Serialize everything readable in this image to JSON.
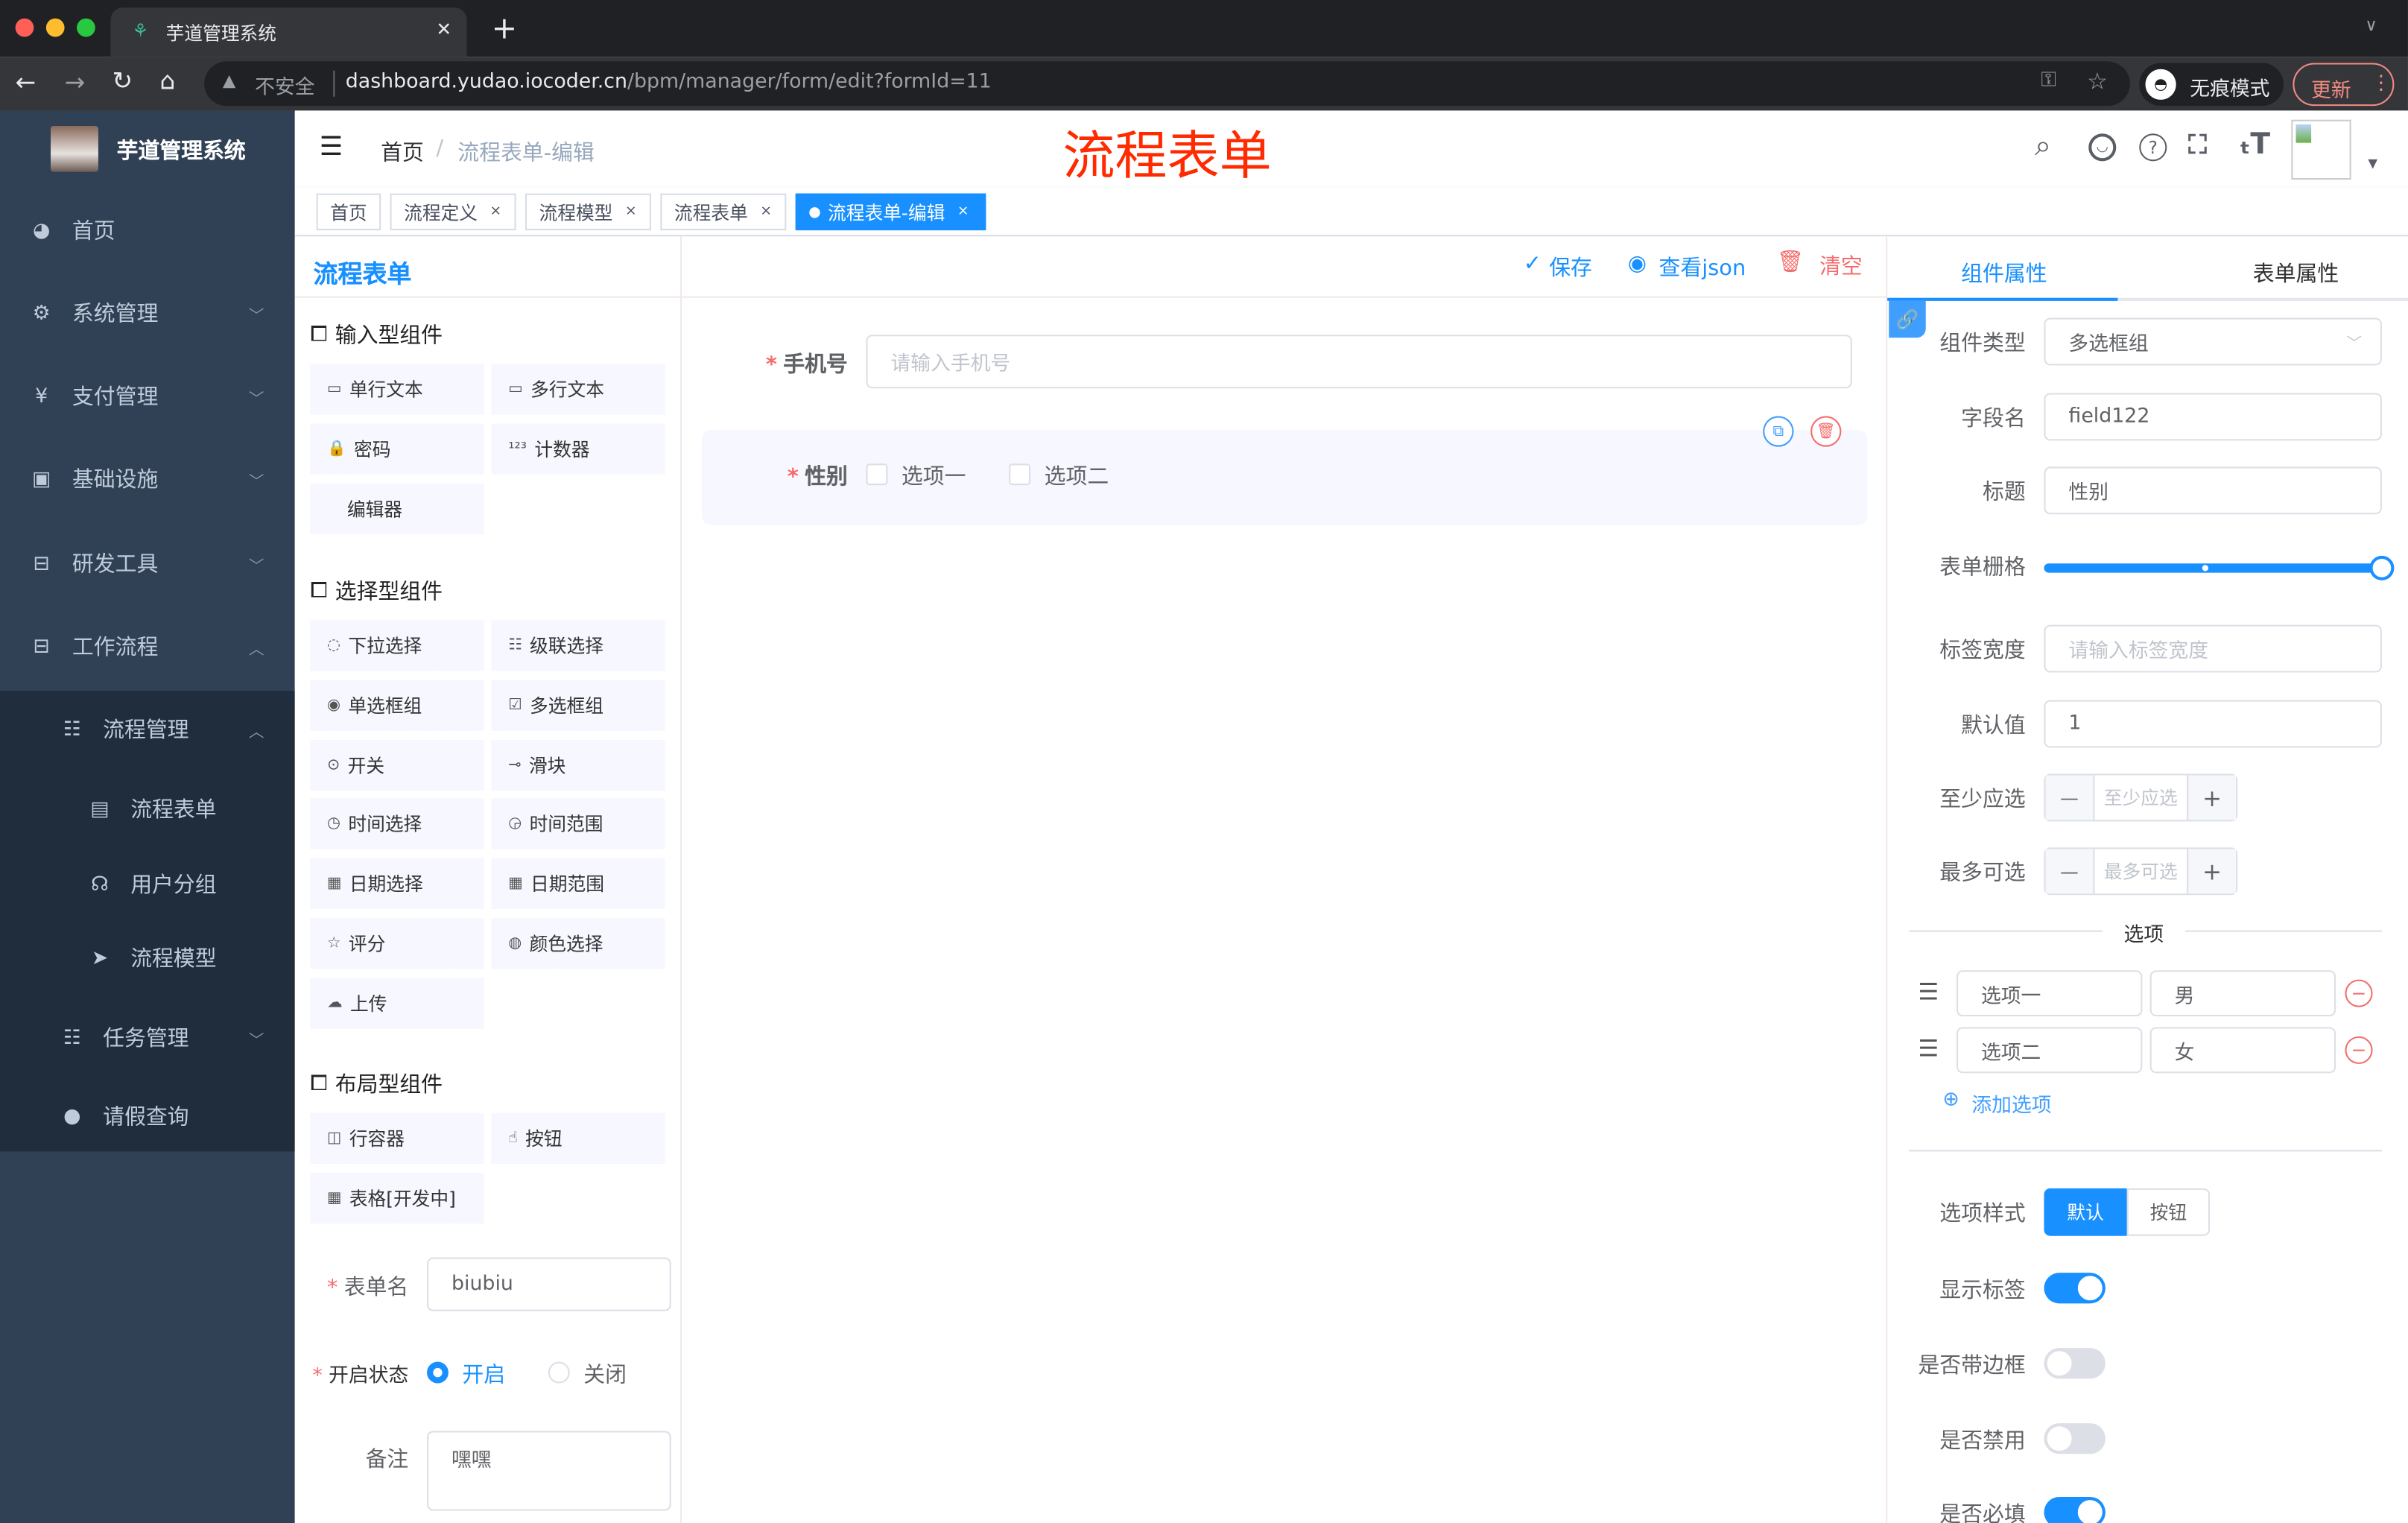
{
  "browser": {
    "tab_title": "芋道管理系统",
    "new_tab": "+",
    "insecure": "不安全",
    "url_host": "dashboard.yudao.iocoder.cn",
    "url_path": "/bpm/manager/form/edit?formId=11",
    "incognito": "无痕模式",
    "update": "更新"
  },
  "sidebar": {
    "title": "芋道管理系统",
    "items": [
      {
        "label": "首页",
        "icon": "dashboard-icon",
        "arrow": ""
      },
      {
        "label": "系统管理",
        "icon": "gear-icon",
        "arrow": "down"
      },
      {
        "label": "支付管理",
        "icon": "yen-icon",
        "arrow": "down"
      },
      {
        "label": "基础设施",
        "icon": "monitor-icon",
        "arrow": "down"
      },
      {
        "label": "研发工具",
        "icon": "toolbox-icon",
        "arrow": "down"
      },
      {
        "label": "工作流程",
        "icon": "toolbox-icon",
        "arrow": "up"
      },
      {
        "label": "流程管理",
        "icon": "tree-icon",
        "arrow": "up",
        "level": 1
      },
      {
        "label": "流程表单",
        "icon": "form-icon",
        "arrow": "",
        "level": 2
      },
      {
        "label": "用户分组",
        "icon": "user-group-icon",
        "arrow": "",
        "level": 2
      },
      {
        "label": "流程模型",
        "icon": "send-icon",
        "arrow": "",
        "level": 2
      },
      {
        "label": "任务管理",
        "icon": "task-icon",
        "arrow": "down",
        "level": 1
      },
      {
        "label": "请假查询",
        "icon": "user-icon",
        "arrow": "",
        "level": 1
      }
    ]
  },
  "navbar": {
    "breadcrumb": [
      "首页",
      "流程表单-编辑"
    ],
    "page_banner": "流程表单"
  },
  "tags": [
    {
      "label": "首页",
      "closable": false,
      "active": false
    },
    {
      "label": "流程定义",
      "closable": true,
      "active": false
    },
    {
      "label": "流程模型",
      "closable": true,
      "active": false
    },
    {
      "label": "流程表单",
      "closable": true,
      "active": false
    },
    {
      "label": "流程表单-编辑",
      "closable": true,
      "active": true
    }
  ],
  "left": {
    "title": "流程表单",
    "groups": [
      {
        "title": "输入型组件",
        "items": [
          {
            "label": "单行文本",
            "icon": "input-icon"
          },
          {
            "label": "多行文本",
            "icon": "textarea-icon"
          },
          {
            "label": "密码",
            "icon": "lock-icon"
          },
          {
            "label": "计数器",
            "icon": "number-icon"
          },
          {
            "label": "编辑器",
            "icon": ""
          }
        ]
      },
      {
        "title": "选择型组件",
        "items": [
          {
            "label": "下拉选择",
            "icon": "select-icon"
          },
          {
            "label": "级联选择",
            "icon": "cascader-icon"
          },
          {
            "label": "单选框组",
            "icon": "radio-icon"
          },
          {
            "label": "多选框组",
            "icon": "checkbox-icon"
          },
          {
            "label": "开关",
            "icon": "switch-icon"
          },
          {
            "label": "滑块",
            "icon": "slider-icon"
          },
          {
            "label": "时间选择",
            "icon": "clock-icon"
          },
          {
            "label": "时间范围",
            "icon": "time-range-icon"
          },
          {
            "label": "日期选择",
            "icon": "calendar-icon"
          },
          {
            "label": "日期范围",
            "icon": "date-range-icon"
          },
          {
            "label": "评分",
            "icon": "star-icon"
          },
          {
            "label": "颜色选择",
            "icon": "palette-icon"
          },
          {
            "label": "上传",
            "icon": "upload-icon"
          }
        ]
      },
      {
        "title": "布局型组件",
        "items": [
          {
            "label": "行容器",
            "icon": "row-icon"
          },
          {
            "label": "按钮",
            "icon": "hand-icon"
          },
          {
            "label": "表格[开发中]",
            "icon": "table-icon"
          }
        ]
      }
    ],
    "form": {
      "name_label": "表单名",
      "name_value": "biubiu",
      "status_label": "开启状态",
      "status_on": "开启",
      "status_off": "关闭",
      "status_selected": "开启",
      "remark_label": "备注",
      "remark_value": "嘿嘿"
    }
  },
  "toolbar": {
    "save": "保存",
    "view_json": "查看json",
    "clear": "清空"
  },
  "canvas": {
    "phone_label": "手机号",
    "phone_placeholder": "请输入手机号",
    "gender_label": "性别",
    "options": [
      "选项一",
      "选项二"
    ]
  },
  "right": {
    "tabs": [
      "组件属性",
      "表单属性"
    ],
    "active_tab": "组件属性",
    "fields": {
      "type_label": "组件类型",
      "type_value": "多选框组",
      "field_label": "字段名",
      "field_value": "field122",
      "title_label": "标题",
      "title_value": "性别",
      "grid_label": "表单栅格",
      "grid_value": 24,
      "grid_max": 24,
      "label_width_label": "标签宽度",
      "label_width_placeholder": "请输入标签宽度",
      "default_label": "默认值",
      "default_value": "1",
      "min_label": "至少应选",
      "min_placeholder": "至少应选",
      "max_label": "最多可选",
      "max_placeholder": "最多可选"
    },
    "options_title": "选项",
    "options": [
      {
        "label": "选项一",
        "value": "男"
      },
      {
        "label": "选项二",
        "value": "女"
      }
    ],
    "add_option": "添加选项",
    "style_label": "选项样式",
    "style_options": [
      "默认",
      "按钮"
    ],
    "style_selected": "默认",
    "switches": [
      {
        "label": "显示标签",
        "on": true
      },
      {
        "label": "是否带边框",
        "on": false
      },
      {
        "label": "是否禁用",
        "on": false
      },
      {
        "label": "是否必填",
        "on": true
      }
    ]
  },
  "colors": {
    "primary": "#1890ff",
    "sidebar": "#304156",
    "danger": "#f56c6c",
    "banner": "#ff2a00"
  }
}
